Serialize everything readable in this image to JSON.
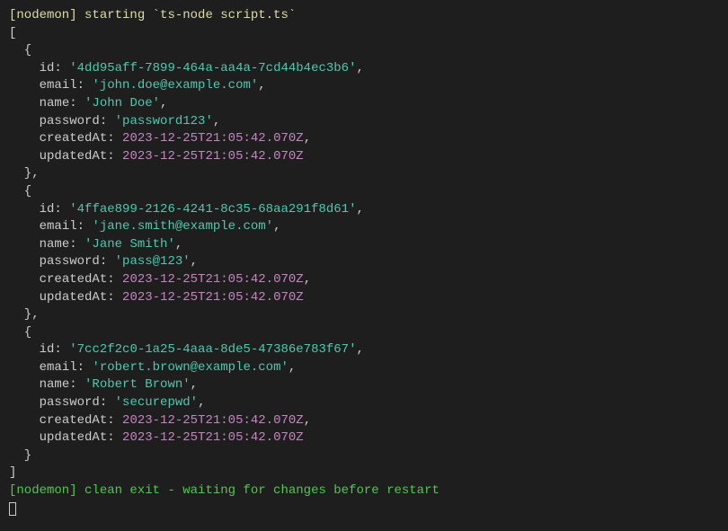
{
  "lines": {
    "start_prefix": "[nodemon]",
    "start_text": " starting `ts-node script.ts`",
    "open_bracket": "[",
    "close_bracket": "]",
    "end_prefix": "[nodemon]",
    "end_text": " clean exit - waiting for changes before restart"
  },
  "labels": {
    "id": "id",
    "email": "email",
    "name": "name",
    "password": "password",
    "createdAt": "createdAt",
    "updatedAt": "updatedAt"
  },
  "records": [
    {
      "id": "'4dd95aff-7899-464a-aa4a-7cd44b4ec3b6'",
      "email": "'john.doe@example.com'",
      "name": "'John Doe'",
      "password": "'password123'",
      "createdAt": "2023-12-25T21:05:42.070Z",
      "updatedAt": "2023-12-25T21:05:42.070Z"
    },
    {
      "id": "'4ffae899-2126-4241-8c35-68aa291f8d61'",
      "email": "'jane.smith@example.com'",
      "name": "'Jane Smith'",
      "password": "'pass@123'",
      "createdAt": "2023-12-25T21:05:42.070Z",
      "updatedAt": "2023-12-25T21:05:42.070Z"
    },
    {
      "id": "'7cc2f2c0-1a25-4aaa-8de5-47386e783f67'",
      "email": "'robert.brown@example.com'",
      "name": "'Robert Brown'",
      "password": "'securepwd'",
      "createdAt": "2023-12-25T21:05:42.070Z",
      "updatedAt": "2023-12-25T21:05:42.070Z"
    }
  ]
}
